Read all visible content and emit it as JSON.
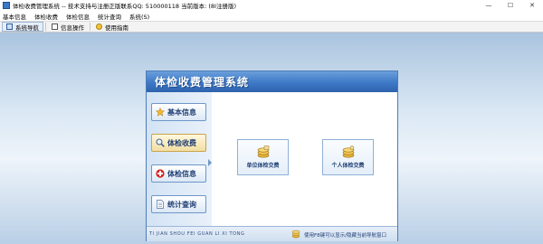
{
  "window": {
    "title": "体检收费管理系统 -- 技术支持与注册正版联系QQ: 510000118     当前版本: (8I注册版)",
    "controls": {
      "minimize": "—",
      "maximize": "☐",
      "close": "✕"
    }
  },
  "menu": {
    "items": [
      "基本信息",
      "体检收费",
      "体检信息",
      "统计查询",
      "系统(S)"
    ]
  },
  "toolbar": {
    "items": [
      {
        "label": "系统导航",
        "icon": "navigation-icon",
        "active": true
      },
      {
        "label": "信息操作",
        "icon": "info-icon",
        "active": false
      },
      {
        "label": "使用指南",
        "icon": "help-icon",
        "active": false
      }
    ]
  },
  "dialog": {
    "title": "体检收费管理系统",
    "sidebar": [
      {
        "label": "基本信息",
        "icon": "star-icon"
      },
      {
        "label": "体检收费",
        "icon": "magnifier-icon",
        "selected": true
      },
      {
        "label": "体检信息",
        "icon": "medical-cross-icon"
      },
      {
        "label": "统计查询",
        "icon": "document-icon"
      }
    ],
    "main_buttons": [
      {
        "label": "单位体检交费",
        "icon": "coins-icon"
      },
      {
        "label": "个人体检交费",
        "icon": "coins-icon"
      }
    ],
    "footer": {
      "pinyin": "TI JIAN SHOU FEI GUAN LI XI TONG",
      "hint": "使用F8键可以显示/隐藏当前导航窗口"
    }
  },
  "colors": {
    "header_blue": "#3d78c6",
    "sidebar_bg": "#d3e3f4",
    "selected_btn": "#f3dea2",
    "desktop_bg": "#dbe8f4"
  }
}
